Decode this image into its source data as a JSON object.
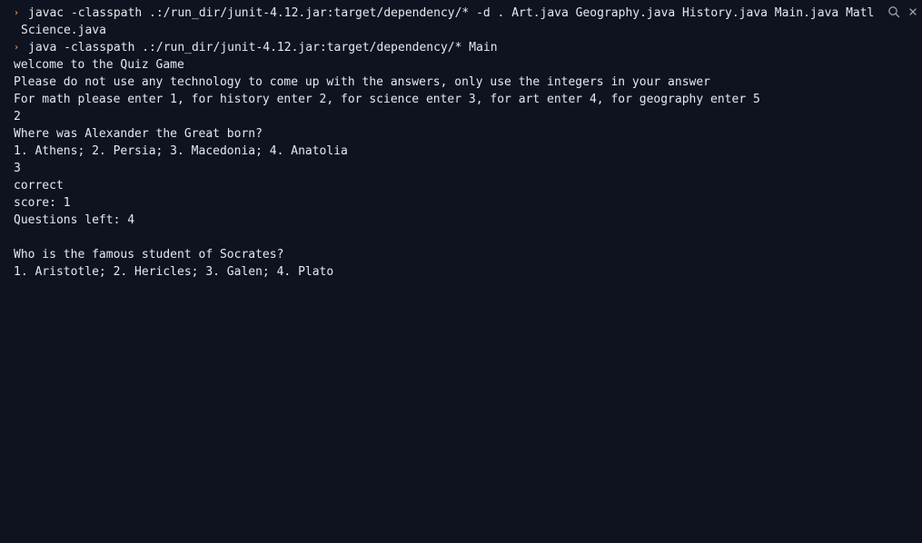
{
  "toolbar": {
    "search_icon": "search-icon",
    "close_icon": "close-icon"
  },
  "colors": {
    "background": "#0f1320",
    "text": "#e6e8ee",
    "prompt": "#f0883e",
    "cursor": "#ffffff"
  },
  "terminal": {
    "prompt_symbol": "›",
    "command1": "javac -classpath .:/run_dir/junit-4.12.jar:target/dependency/* -d . Art.java Geography.java History.java Main.java Matl",
    "command1_cont": "Science.java",
    "command2": "java -classpath .:/run_dir/junit-4.12.jar:target/dependency/* Main",
    "output": {
      "welcome": "welcome to the Quiz Game",
      "instructions": "Please do not use any technology to come up with the answers, only use the integers in your answer",
      "category_prompt": "For math please enter 1, for history enter 2, for science enter 3, for art enter 4, for geography enter 5",
      "category_input": "2",
      "question1": "Where was Alexander the Great born?",
      "question1_options": "1. Athens; 2. Persia; 3. Macedonia; 4. Anatolia",
      "answer1_input": "3",
      "result1": "correct",
      "score": "score: 1",
      "questions_left": "Questions left: 4",
      "question2": "Who is the famous student of Socrates?",
      "question2_options": "1. Aristotle; 2. Hericles; 3. Galen; 4. Plato"
    }
  }
}
